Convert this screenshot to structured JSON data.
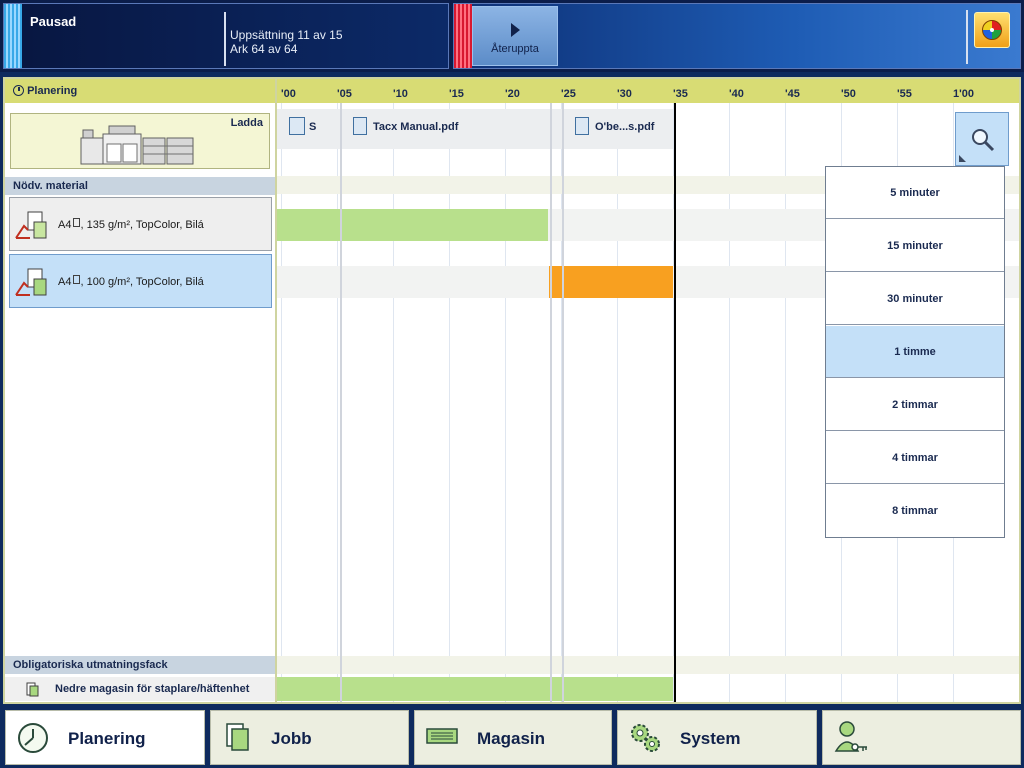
{
  "status": {
    "title": "Pausad",
    "line1": "Uppsättning 11 av 15",
    "line2": "Ark 64 av 64"
  },
  "job_panel": {
    "resume_label": "Återuppta",
    "cd_icon": "cd-disc-icon"
  },
  "planning": {
    "header": "Planering",
    "load_label": "Ladda",
    "material_header": "Nödv. material",
    "materials": [
      {
        "size": "A4",
        "desc": ", 135 g/m², TopColor, Bilá"
      },
      {
        "size": "A4",
        "desc": ", 100 g/m², TopColor, Bilá"
      }
    ],
    "output_header": "Obligatoriska utmatningsfack",
    "output_item": "Nedre magasin för staplare/häftenhet"
  },
  "timeline": {
    "ticks": [
      "'00",
      "'05",
      "'10",
      "'15",
      "'20",
      "'25",
      "'30",
      "'35",
      "'40",
      "'45",
      "'50",
      "'55",
      "1'00"
    ],
    "jobs": [
      "S",
      "Tacx Manual.pdf",
      "O'be...s.pdf"
    ],
    "colors": {
      "done": "#b8e08c",
      "active": "#f8a020",
      "now_line": "#000000"
    }
  },
  "zoom_menu": {
    "options": [
      "5 minuter",
      "15 minuter",
      "30 minuter",
      "1 timme",
      "2 timmar",
      "4 timmar",
      "8 timmar"
    ],
    "selected": "1 timme"
  },
  "nav": {
    "tabs": [
      {
        "label": "Planering",
        "icon": "clock-icon"
      },
      {
        "label": "Jobb",
        "icon": "document-icon"
      },
      {
        "label": "Magasin",
        "icon": "paper-tray-icon"
      },
      {
        "label": "System",
        "icon": "gears-icon"
      },
      {
        "label": "",
        "icon": "user-key-icon"
      }
    ]
  }
}
